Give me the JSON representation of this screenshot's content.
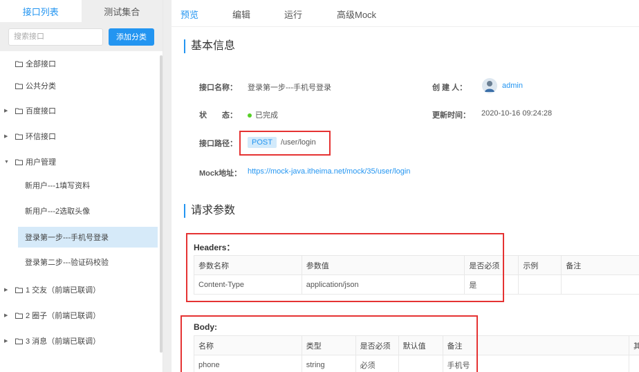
{
  "sidebar": {
    "tabs": [
      {
        "label": "接口列表",
        "active": true
      },
      {
        "label": "测试集合",
        "active": false
      }
    ],
    "search": {
      "placeholder": "搜索接口",
      "value": ""
    },
    "add_category_label": "添加分类",
    "tree": [
      {
        "label": "全部接口",
        "type": "folder",
        "expandable": false
      },
      {
        "label": "公共分类",
        "type": "folder",
        "expandable": false
      },
      {
        "label": "百度接口",
        "type": "folder",
        "expandable": true,
        "expanded": false
      },
      {
        "label": "环信接口",
        "type": "folder",
        "expandable": true,
        "expanded": false
      },
      {
        "label": "用户管理",
        "type": "folder",
        "expandable": true,
        "expanded": true
      },
      {
        "label": "新用户---1填写资料",
        "type": "item"
      },
      {
        "label": "新用户---2选取头像",
        "type": "item"
      },
      {
        "label": "登录第一步---手机号登录",
        "type": "item",
        "selected": true
      },
      {
        "label": "登录第二步---验证码校验",
        "type": "item"
      },
      {
        "label": "1 交友（前端已联调）",
        "type": "folder",
        "expandable": true,
        "expanded": false
      },
      {
        "label": "2 圈子（前端已联调）",
        "type": "folder",
        "expandable": true,
        "expanded": false
      },
      {
        "label": "3 消息（前端已联调）",
        "type": "folder",
        "expandable": true,
        "expanded": false
      }
    ]
  },
  "top_tabs": [
    {
      "label": "预览",
      "active": true
    },
    {
      "label": "编辑",
      "active": false
    },
    {
      "label": "运行",
      "active": false
    },
    {
      "label": "高级Mock",
      "active": false
    }
  ],
  "basic_info": {
    "title": "基本信息",
    "name_label": "接口名称：",
    "name_value": "登录第一步---手机号登录",
    "creator_label": "创 建 人：",
    "creator_value": "admin",
    "status_label": "状　　态：",
    "status_value": "已完成",
    "updated_label": "更新时间：",
    "updated_value": "2020-10-16 09:24:28",
    "path_label": "接口路径：",
    "method": "POST",
    "path": "/user/login",
    "mock_label": "Mock地址：",
    "mock_url": "https://mock-java.itheima.net/mock/35/user/login"
  },
  "request_params": {
    "title": "请求参数",
    "headers": {
      "title": "Headers：",
      "columns": [
        "参数名称",
        "参数值",
        "是否必须",
        "示例",
        "备注"
      ],
      "rows": [
        [
          "Content-Type",
          "application/json",
          "是",
          "",
          ""
        ]
      ]
    },
    "body": {
      "title": "Body:",
      "columns": [
        "名称",
        "类型",
        "是否必须",
        "默认值",
        "备注",
        "其"
      ],
      "rows": [
        [
          "phone",
          "string",
          "必须",
          "",
          "手机号",
          ""
        ]
      ]
    }
  },
  "colors": {
    "accent": "#2395f1",
    "highlight_box": "#e53232",
    "status_done": "#57cf27",
    "selected_bg": "#d6eaf9"
  }
}
